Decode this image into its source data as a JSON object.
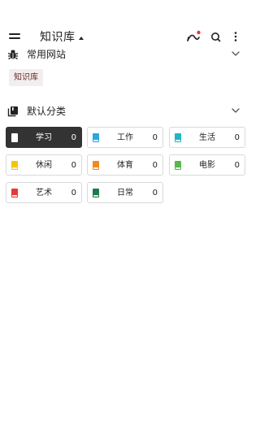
{
  "header": {
    "title": "知识库",
    "icons": [
      "menu-icon",
      "caret-up-icon",
      "sync-icon",
      "search-icon",
      "more-vert-icon"
    ],
    "notification_dot_color": "#e53935"
  },
  "sections": {
    "favorites": {
      "title": "常用网站",
      "icon": "bug-icon",
      "tag": "知识库"
    },
    "categories": {
      "title": "默认分类",
      "icon": "library-icon"
    }
  },
  "categories": [
    {
      "name": "学习",
      "count": "0",
      "color": "#ffffff",
      "active": true
    },
    {
      "name": "工作",
      "count": "0",
      "color": "#2aa6e0"
    },
    {
      "name": "生活",
      "count": "0",
      "color": "#21b8c4"
    },
    {
      "name": "休闲",
      "count": "0",
      "color": "#f5c400"
    },
    {
      "name": "体育",
      "count": "0",
      "color": "#f08a1c"
    },
    {
      "name": "电影",
      "count": "0",
      "color": "#55b94a"
    },
    {
      "name": "艺术",
      "count": "0",
      "color": "#e53935"
    },
    {
      "name": "日常",
      "count": "0",
      "color": "#1e7a4c"
    }
  ]
}
